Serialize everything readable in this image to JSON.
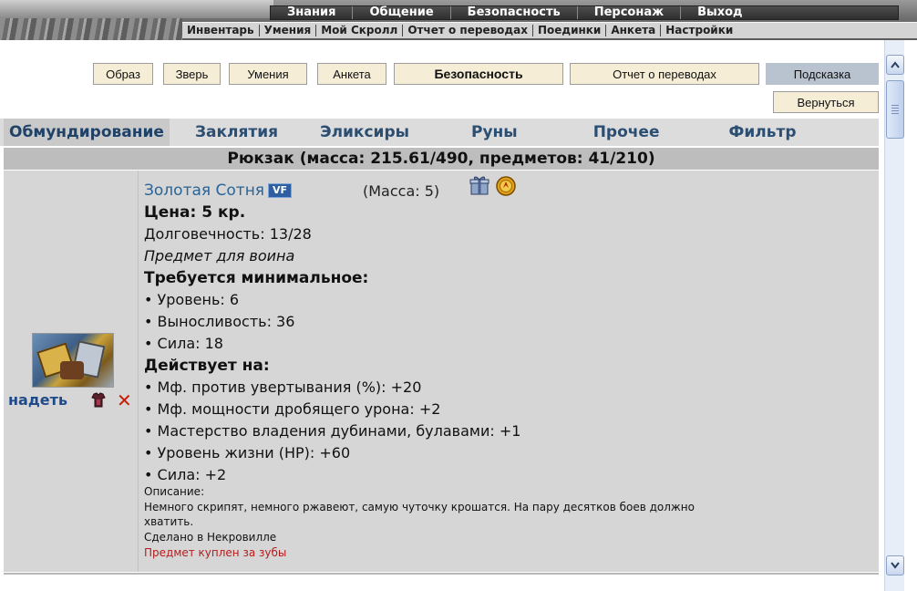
{
  "top_menu": {
    "primary": [
      "Знания",
      "Общение",
      "Безопасность",
      "Персонаж",
      "Выход"
    ],
    "secondary": [
      "Инвентарь",
      "Умения",
      "Мой Скролл",
      "Отчет о переводах",
      "Поединки",
      "Анкета",
      "Настройки"
    ]
  },
  "buttons": {
    "obraz": "Образ",
    "zver": "Зверь",
    "umeniya": "Умения",
    "anketa": "Анкета",
    "bezopasnost": "Безопасность",
    "otchet": "Отчет о переводах",
    "podskazka": "Подсказка",
    "vernutsya": "Вернуться"
  },
  "tabs": [
    "Обмундирование",
    "Заклятия",
    "Эликсиры",
    "Руны",
    "Прочее",
    "Фильтр"
  ],
  "backpack": "Рюкзак (масса: 215.61/490, предметов: 41/210)",
  "item": {
    "name": "Золотая Сотня",
    "badge": "VF",
    "mass": "(Масса: 5)",
    "price": "Цена: 5 кр.",
    "durability": "Долговечность: 13/28",
    "class_note": "Предмет для воина",
    "req_title": "Требуется минимальное:",
    "requirements": [
      "• Уровень: 6",
      "• Выносливость: 36",
      "• Сила: 18"
    ],
    "effects_title": "Действует на:",
    "effects": [
      "• Мф. против увертывания (%): +20",
      "• Мф. мощности дробящего урона: +2",
      "• Мастерство владения дубинами, булавами: +1",
      "• Уровень жизни (HP): +60",
      "• Сила: +2"
    ],
    "desc_label": "Описание:",
    "desc_line1": "Немного скрипят, немного ржавеют, самую чуточку крошатся. На пару десятков боев должно",
    "desc_line2": "хватить.",
    "made_in": "Сделано в Некровилле",
    "bought_note": "Предмет куплен за зубы",
    "action_wear": "надеть"
  },
  "icons": {
    "gift": "gift-icon",
    "gold": "gold-coin-icon",
    "wear": "armor-icon",
    "delete": "close-icon"
  }
}
